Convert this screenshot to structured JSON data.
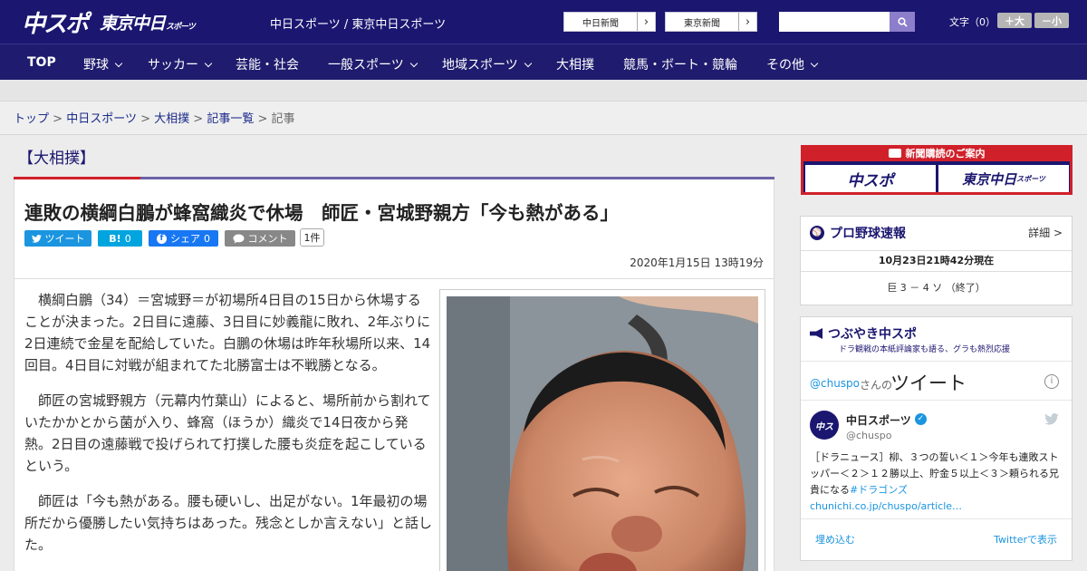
{
  "header": {
    "logo_main": "中スポ",
    "logo_tokyo": "東京中日",
    "logo_tokyo_small": "スポーツ",
    "site_links": "中日スポーツ / 東京中日スポーツ",
    "chunichi_button": "中日新聞",
    "tokyo_button": "東京新聞",
    "search_placeholder": "",
    "font_size_label": "文字（0）",
    "font_plus": "＋大",
    "font_minus": "－小"
  },
  "nav": [
    {
      "label": "TOP",
      "dropdown": false
    },
    {
      "label": "野球",
      "dropdown": true
    },
    {
      "label": "サッカー",
      "dropdown": true
    },
    {
      "label": "芸能・社会",
      "dropdown": false
    },
    {
      "label": "一般スポーツ",
      "dropdown": true
    },
    {
      "label": "地域スポーツ",
      "dropdown": true
    },
    {
      "label": "大相撲",
      "dropdown": false
    },
    {
      "label": "競馬・ボート・競輪",
      "dropdown": false
    },
    {
      "label": "その他",
      "dropdown": true
    }
  ],
  "breadcrumb": {
    "items": [
      "トップ",
      "中日スポーツ",
      "大相撲",
      "記事一覧"
    ],
    "sep": ">",
    "current": "記事"
  },
  "article": {
    "category": "【大相撲】",
    "title": "連敗の横綱白鵬が蜂窩織炎で休場　師匠・宮城野親方「今も熱がある」",
    "share": {
      "tweet": "ツイート",
      "hatena": "B!",
      "hatena_count": "0",
      "facebook": "シェア",
      "facebook_count": "0",
      "comment": "コメント",
      "comment_count": "1件"
    },
    "date": "2020年1月15日 13時19分",
    "paragraphs": [
      "横綱白鵬（34）＝宮城野＝が初場所4日目の15日から休場することが決まった。2日目に遠藤、3日目に妙義龍に敗れ、2年ぶりに2日連続で金星を配給していた。白鵬の休場は昨年秋場所以来、14回目。4日目に対戦が組まれてた北勝富士は不戦勝となる。",
      "師匠の宮城野親方（元幕内竹葉山）によると、場所前から割れていたかかとから菌が入り、蜂窩（ほうか）織炎で14日夜から発熱。2日目の遠藤戦で投げられて打撲した腰も炎症を起こしているという。",
      "師匠は「今も熱がある。腰も硬いし、出足がない。1年最初の場所だから優勝したい気持ちはあった。残念としか言えない」と話した。"
    ]
  },
  "sidebar": {
    "promo": {
      "header": "新聞購読のご案内",
      "left": "中スポ",
      "right": "東京中日",
      "right_small": "スポーツ"
    },
    "baseball": {
      "title": "プロ野球速報",
      "more": "詳細 >",
      "updated": "10月23日21時42分現在",
      "score": "巨 3 － 4 ソ （終了）"
    },
    "tweets": {
      "title": "つぶやき中スポ",
      "subtitle": "ドラ観戦の本紙評論家も語る、グラも熱烈応援",
      "handle": "@chuspo",
      "handle_suffix": "さんの",
      "tweet_word": "ツイート",
      "user_name": "中日スポーツ",
      "user_handle": "@chuspo",
      "tweet_text": "［ドラニュース］柳、３つの誓い＜１＞今年も連敗ストッパー＜２＞１２勝以上、貯金５以上＜３＞頼られる兄貴になる",
      "tweet_hashtag": "#ドラゴンズ",
      "tweet_link": "chunichi.co.jp/chuspo/article…",
      "embed": "埋め込む",
      "view_on": "Twitterで表示"
    }
  },
  "colors": {
    "brand_navy": "#1b1670",
    "accent_red": "#d0212b",
    "twitter": "#1b95e0",
    "hatena": "#00a4de",
    "facebook": "#1877f2",
    "comment": "#888888"
  }
}
